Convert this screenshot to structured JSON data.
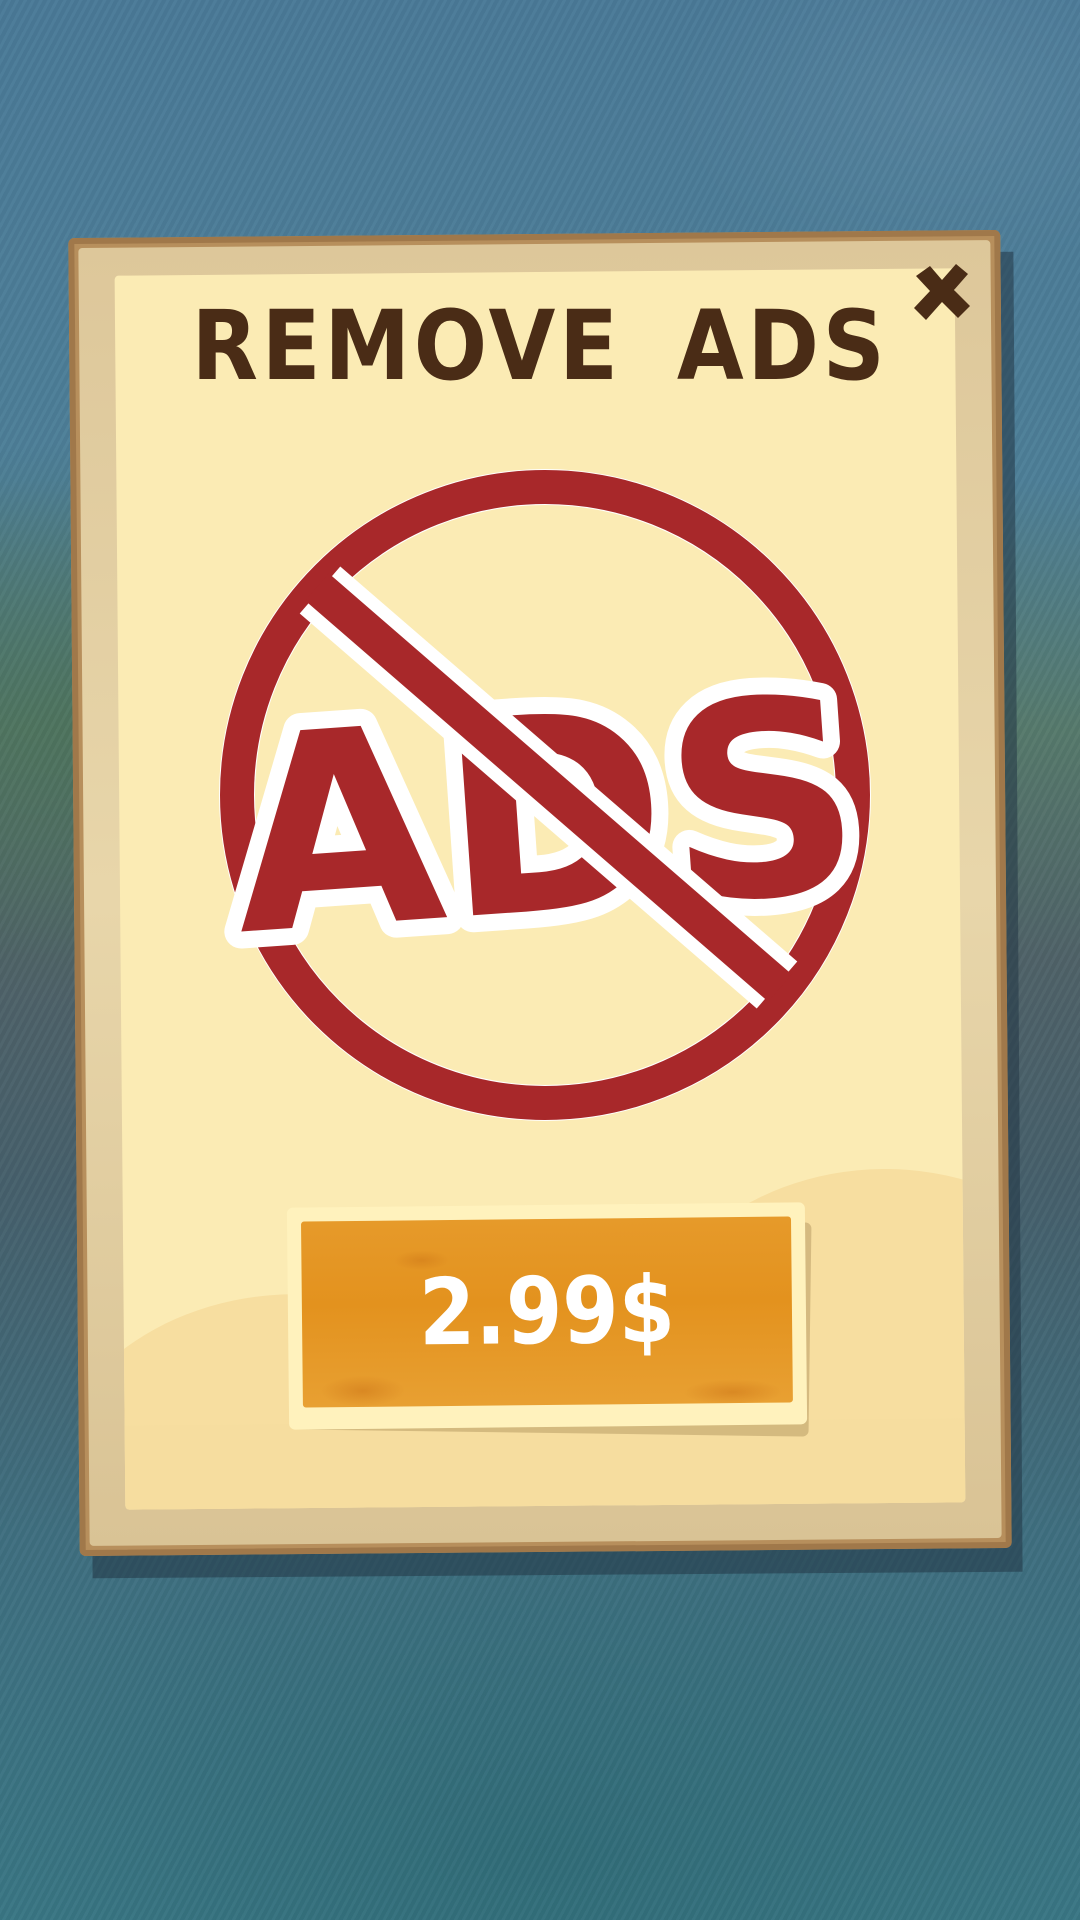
{
  "dialog": {
    "title": "REMOVE ADS",
    "close_icon": "close-x-icon",
    "badge_text": "ADS",
    "badge_icon": "no-ads-prohibition-icon"
  },
  "purchase": {
    "price_label": "2.99$"
  },
  "colors": {
    "title": "#4a2c16",
    "prohibition_red": "#a8282a",
    "button_orange": "#e3921e",
    "paper": "#fbebb4"
  }
}
